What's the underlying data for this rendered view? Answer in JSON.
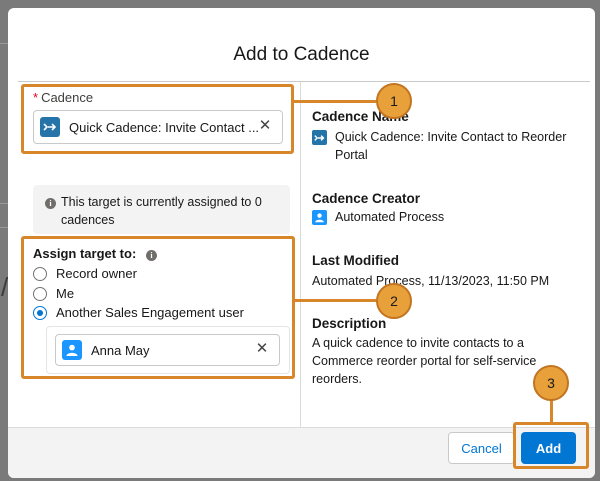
{
  "modal": {
    "title": "Add to Cadence"
  },
  "cadence_field": {
    "label": "Cadence",
    "required_marker": "*",
    "value": "Quick Cadence: Invite Contact ...",
    "icon": "cadence-icon",
    "clear_icon": "close-icon"
  },
  "info": {
    "text": "This target is currently assigned to 0 cadences",
    "icon": "info-icon"
  },
  "assign": {
    "title": "Assign target to:",
    "options": [
      {
        "label": "Record owner",
        "checked": false
      },
      {
        "label": "Me",
        "checked": false
      },
      {
        "label": "Another Sales Engagement user",
        "checked": true
      }
    ],
    "user": {
      "name": "Anna May",
      "icon": "user-icon"
    }
  },
  "details": {
    "cadence_name_label": "Cadence Name",
    "cadence_name_value": "Quick Cadence: Invite Contact to Reorder Portal",
    "creator_label": "Cadence Creator",
    "creator_value": "Automated Process",
    "modified_label": "Last Modified",
    "modified_value": "Automated Process, 11/13/2023, 11:50 PM",
    "description_label": "Description",
    "description_value": "A quick cadence to invite contacts to a Commerce reorder portal for self-service reorders."
  },
  "footer": {
    "cancel_label": "Cancel",
    "add_label": "Add"
  },
  "callouts": [
    "1",
    "2",
    "3"
  ],
  "colors": {
    "brand": "#0176d3",
    "callout": "#d8862a",
    "callout_fill": "#e8a13a",
    "required": "#ea001e"
  }
}
